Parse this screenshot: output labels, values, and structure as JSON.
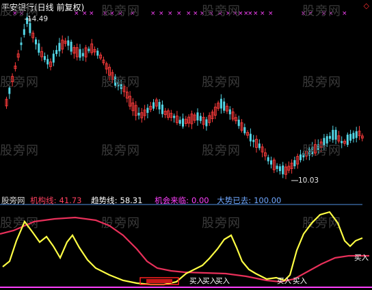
{
  "header": {
    "title": "平安银行(日线 前复权)",
    "corner_marker": "◇"
  },
  "watermark": "股旁网",
  "price_panel": {
    "high_label": "14.49",
    "low_label": "10.03",
    "colors": {
      "up": "#ff3c3c",
      "down": "#54d6e6",
      "marker": "#ff44ff"
    }
  },
  "indicator_bar": {
    "name": "股旁网",
    "jigou_label": "机构线:",
    "jigou_value": "41.73",
    "qushi_label": "趋势线:",
    "qushi_value": "58.31",
    "jihui_label": "机会来临:",
    "jihui_value": "0.00",
    "dashi_label": "大势已去:",
    "dashi_value": "100.00"
  },
  "indicator_panel": {
    "buy_label": "买入",
    "colors": {
      "jigou": "#e8305a",
      "qushi": "#ffff44",
      "jihui": "#ff40ff",
      "dashi": "#4f8fdf"
    }
  },
  "chart_data": {
    "type": "candlestick",
    "title": "平安银行(日线 前复权)",
    "annotations": [
      "14.49",
      "10.03"
    ],
    "price_max": 14.49,
    "price_min": 10.03,
    "indicator_values": {
      "机构线": 41.73,
      "趋势线": 58.31,
      "机会来临": 0.0,
      "大势已去": 100.0
    },
    "buy_signals": 6
  }
}
